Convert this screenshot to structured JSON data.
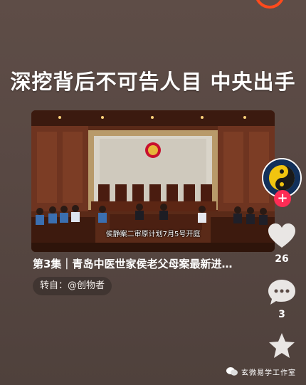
{
  "headline": "深挖背后不可告人目 中央出手",
  "video": {
    "subtitle": "侯静案二审原计划7月5号开庭"
  },
  "caption": "第3集｜青岛中医世家侯老父母案最新进…",
  "repost_label": "转自：@创物者",
  "actions": {
    "like_count": "26",
    "comment_count": "3"
  },
  "watermark": "玄微易学工作室",
  "colors": {
    "background": "#5a4a45",
    "follow": "#fe2c55",
    "top_ring": "#ff4a1c"
  }
}
